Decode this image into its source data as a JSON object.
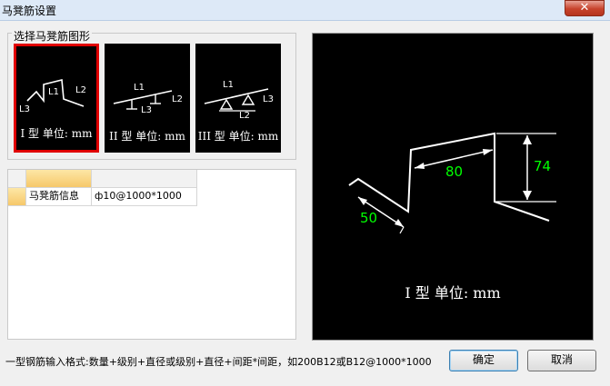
{
  "window": {
    "title": "马凳筋设置",
    "close_glyph": "✕"
  },
  "shape_group": {
    "label": "选择马凳筋图形",
    "selected_index": 0,
    "options": [
      {
        "caption": "I 型  单位: mm",
        "labels": [
          "L1",
          "L2",
          "L3"
        ]
      },
      {
        "caption": "II 型  单位: mm",
        "labels": [
          "L1",
          "L2",
          "L3"
        ]
      },
      {
        "caption": "III 型  单位: mm",
        "labels": [
          "L1",
          "L2",
          "L3"
        ]
      }
    ]
  },
  "grid": {
    "rows": [
      {
        "name": "马凳筋信息",
        "value": "ф10@1000*1000"
      }
    ]
  },
  "preview": {
    "caption": "I 型  单位: mm",
    "dimensions": {
      "L1": "80",
      "L2": "74",
      "L3": "50"
    }
  },
  "hint_text": "一型钢筋输入格式:数量+级别+直径或级别+直径+间距*间距，如200B12或B12@1000*1000",
  "buttons": {
    "ok": "确定",
    "cancel": "取消"
  },
  "colors": {
    "selected_border": "#e00000",
    "dimension_text": "#00ff00",
    "header_highlight": "#f6c86a"
  }
}
